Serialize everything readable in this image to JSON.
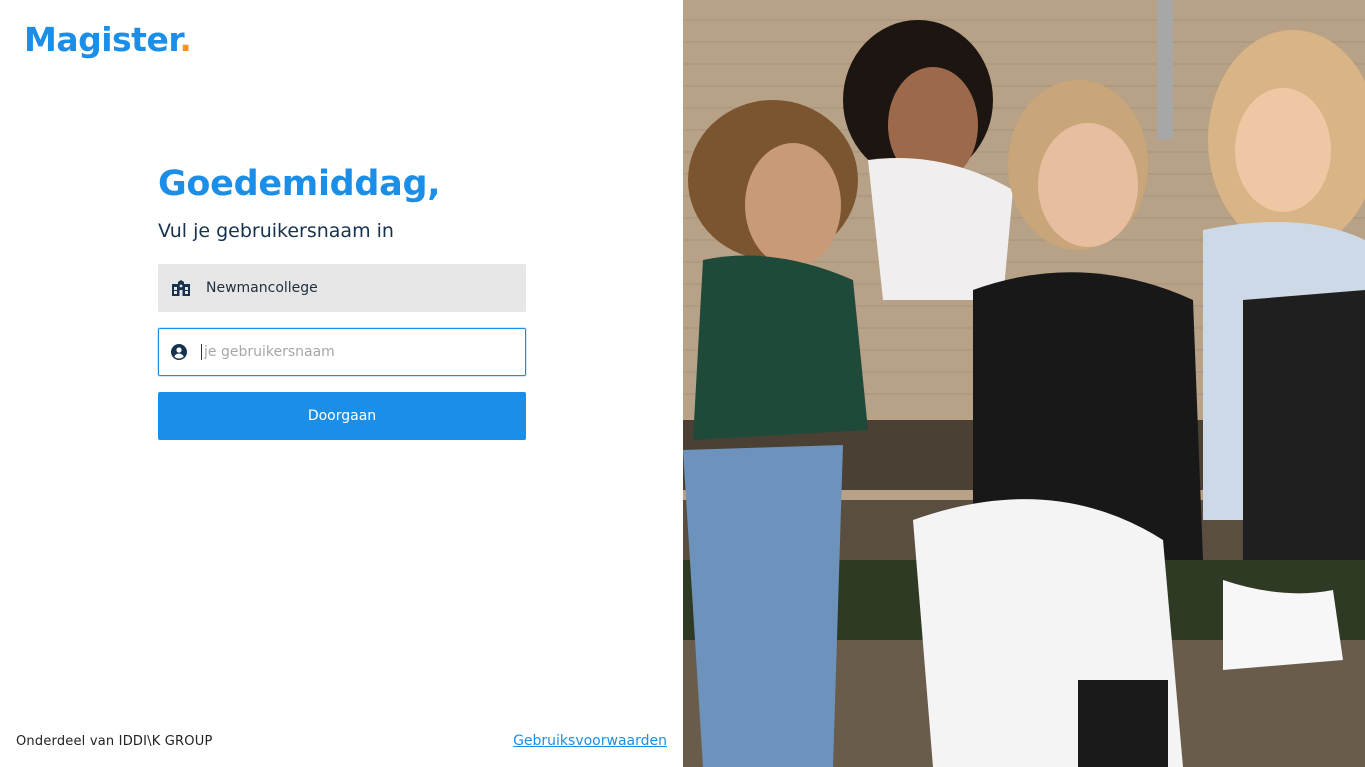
{
  "brand": {
    "logo_text": "Magister",
    "logo_dot": ".",
    "accent_color": "#1b8fe8",
    "dot_color": "#f7931e"
  },
  "login": {
    "greeting": "Goedemiddag,",
    "subtitle": "Vul je gebruikersnaam in",
    "school_name": "Newmancollege",
    "school_icon": "school-building-icon",
    "username_placeholder": "je gebruikersnaam",
    "username_value": "",
    "username_icon": "user-circle-icon",
    "submit_label": "Doorgaan"
  },
  "footer": {
    "brand_text": "Onderdeel van IDDI\\K GROUP",
    "terms_link": "Gebruiksvoorwaarden"
  },
  "hero": {
    "description_icon": "hero-photo"
  }
}
